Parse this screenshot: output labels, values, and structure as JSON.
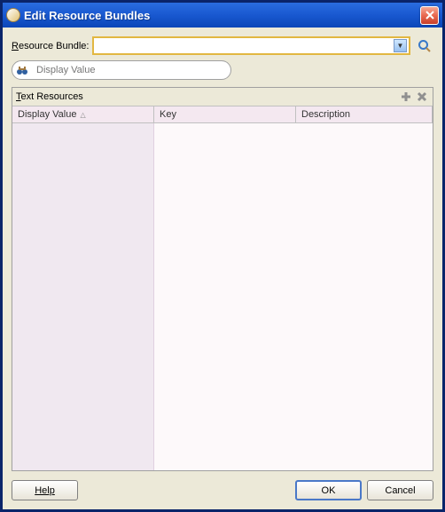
{
  "window": {
    "title": "Edit Resource Bundles"
  },
  "form": {
    "bundle_label_pre": "R",
    "bundle_label_post": "esource Bundle:",
    "bundle_value": "",
    "search_placeholder": "Display Value"
  },
  "table": {
    "title_mnemonic": "T",
    "title_rest": "ext Resources",
    "columns": {
      "display": "Display Value",
      "key": "Key",
      "description": "Description"
    }
  },
  "buttons": {
    "help": "Help",
    "ok": "OK",
    "cancel": "Cancel"
  }
}
